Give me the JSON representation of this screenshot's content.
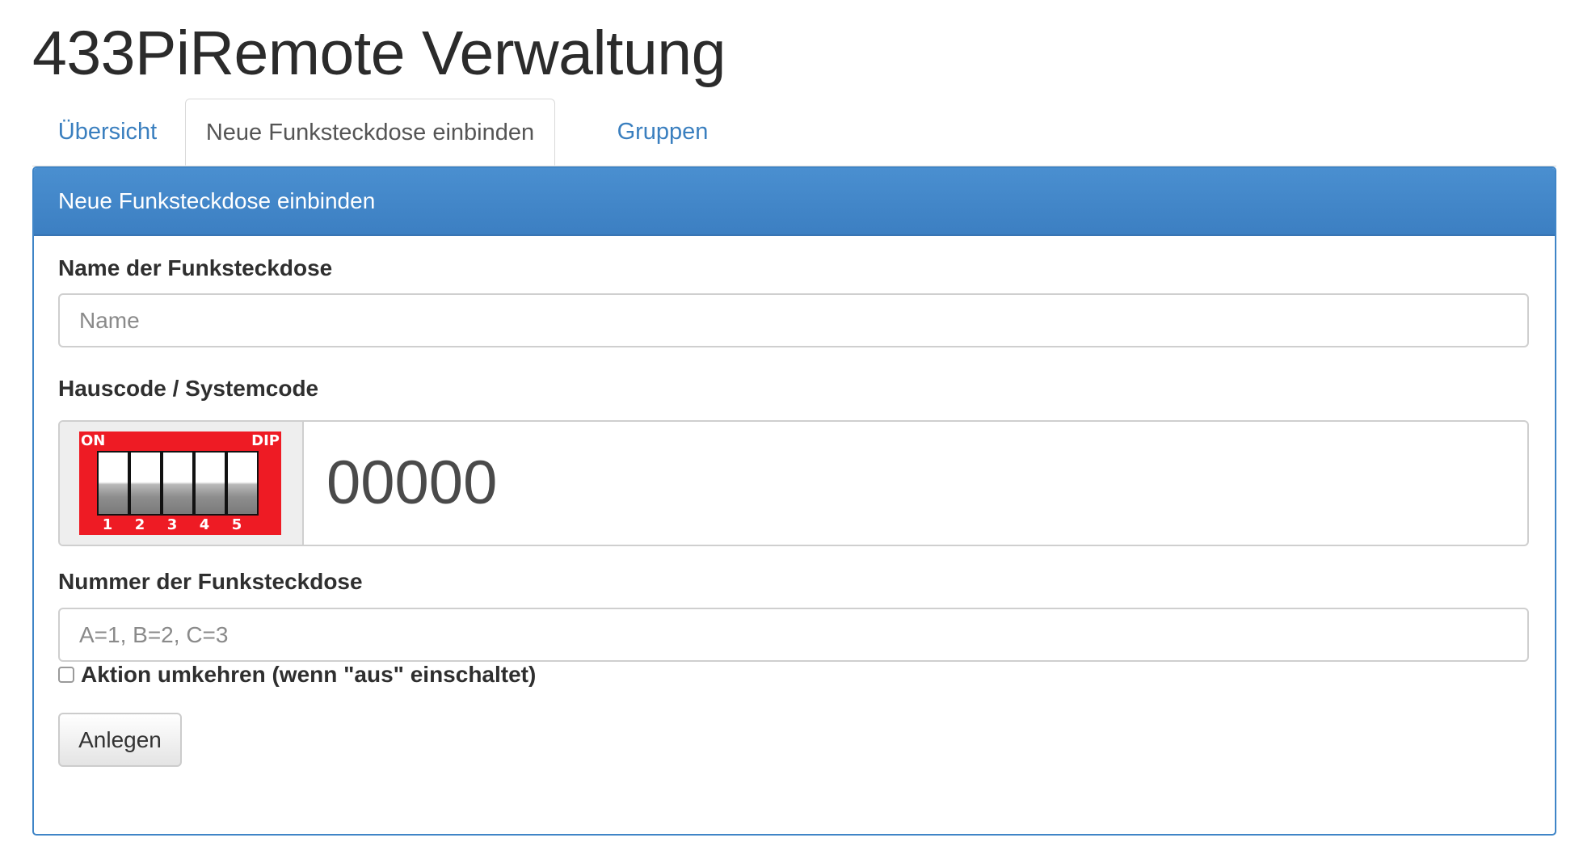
{
  "app": {
    "title": "433PiRemote Verwaltung"
  },
  "tabs": [
    {
      "label": "Übersicht",
      "active": false
    },
    {
      "label": "Neue Funksteckdose einbinden",
      "active": true
    },
    {
      "label": "Gruppen",
      "active": false
    }
  ],
  "panel": {
    "heading": "Neue Funksteckdose einbinden",
    "name_field": {
      "label": "Name der Funksteckdose",
      "placeholder": "Name",
      "value": ""
    },
    "code_field": {
      "label": "Hauscode / Systemcode",
      "dip": {
        "on_label": "ON",
        "dip_label": "DIP",
        "switches": [
          {
            "number": "1",
            "on": false
          },
          {
            "number": "2",
            "on": false
          },
          {
            "number": "3",
            "on": false
          },
          {
            "number": "4",
            "on": false
          },
          {
            "number": "5",
            "on": false
          }
        ]
      },
      "value": "00000"
    },
    "number_field": {
      "label": "Nummer der Funksteckdose",
      "placeholder": "A=1, B=2, C=3",
      "value": ""
    },
    "invert_checkbox": {
      "label": "Aktion umkehren (wenn \"aus\" einschaltet)",
      "checked": false
    },
    "submit_button": {
      "label": "Anlegen"
    }
  },
  "colors": {
    "accent": "#3f85c7",
    "link": "#3a7fbf",
    "dip_red": "#ee1b24"
  }
}
